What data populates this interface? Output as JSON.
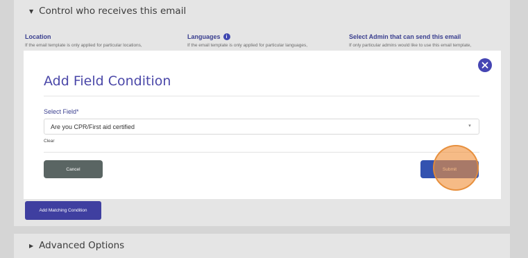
{
  "background": {
    "control_section": {
      "title": "Control who receives this email",
      "columns": [
        {
          "title": "Location",
          "description": "If the email template is only applied for particular locations,"
        },
        {
          "title": "Languages",
          "description": "If the email template is only applied for particular languages,"
        },
        {
          "title": "Select Admin that can send this email",
          "description": "If only particular admins would like to use this email template,"
        }
      ],
      "add_matching_label": "Add Matching Condition"
    },
    "advanced_section": {
      "title": "Advanced Options"
    }
  },
  "modal": {
    "title": "Add Field Condition",
    "field_label": "Select Field*",
    "selected_value": "Are you CPR/First aid certified",
    "clear_label": "Clear",
    "cancel_label": "Cancel",
    "submit_label": "Submit"
  },
  "icons": {
    "caret": "caret-down",
    "info": "info-circle",
    "close": "close-x-circle",
    "dropdown": "chevron-down"
  },
  "colors": {
    "accent_purple": "#4a47a8",
    "cancel_button": "#5a6563",
    "submit_button": "#3352b0",
    "click_highlight": "#f0913c"
  }
}
